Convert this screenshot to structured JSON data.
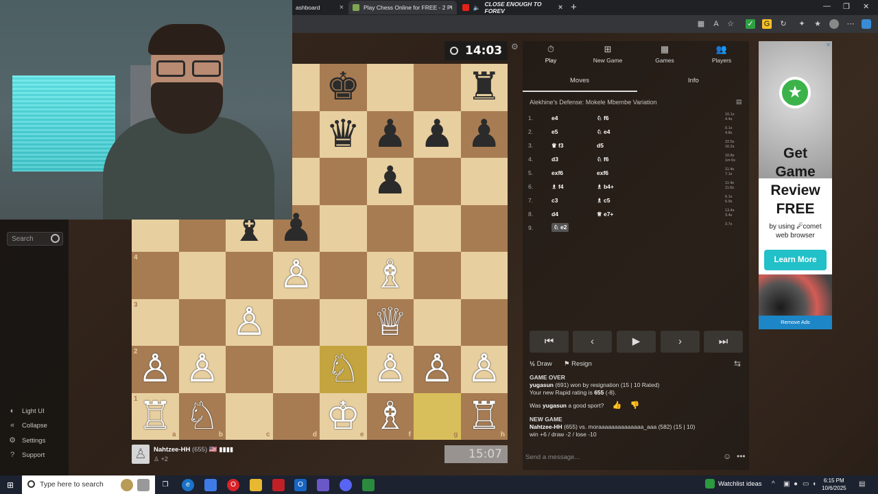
{
  "browser": {
    "tabs": [
      {
        "label": "ashboard",
        "active": false
      },
      {
        "label": "Play Chess Online for FREE - 2 Pl",
        "active": true
      },
      {
        "label": "CLOSE ENOUGH TO FOREV",
        "active": false
      }
    ],
    "new_tab": "+",
    "controls": [
      "—",
      "❐",
      "✕"
    ]
  },
  "sidebar": {
    "search_placeholder": "Search",
    "items": [
      {
        "label": "Light UI",
        "icon": "contrast-icon"
      },
      {
        "label": "Collapse",
        "icon": "collapse-icon"
      },
      {
        "label": "Settings",
        "icon": "gear-icon"
      },
      {
        "label": "Support",
        "icon": "help-icon"
      }
    ]
  },
  "top_timer": "14:03",
  "board": {
    "files": [
      "a",
      "b",
      "c",
      "d",
      "e",
      "f",
      "g",
      "h"
    ],
    "rank_labels_shown": [
      "4",
      "3",
      "2",
      "1"
    ],
    "pieces": [
      {
        "sq": "e8",
        "p": "♚",
        "c": "b"
      },
      {
        "sq": "h8",
        "p": "♜",
        "c": "b"
      },
      {
        "sq": "e7",
        "p": "♛",
        "c": "b"
      },
      {
        "sq": "f7",
        "p": "♟",
        "c": "b"
      },
      {
        "sq": "g7",
        "p": "♟",
        "c": "b"
      },
      {
        "sq": "h7",
        "p": "♟",
        "c": "b"
      },
      {
        "sq": "f6",
        "p": "♟",
        "c": "b"
      },
      {
        "sq": "c5",
        "p": "♝",
        "c": "b"
      },
      {
        "sq": "d5",
        "p": "♟",
        "c": "b"
      },
      {
        "sq": "d4",
        "p": "♙",
        "c": "w"
      },
      {
        "sq": "f4",
        "p": "♗",
        "c": "w"
      },
      {
        "sq": "c3",
        "p": "♙",
        "c": "w"
      },
      {
        "sq": "f3",
        "p": "♕",
        "c": "w"
      },
      {
        "sq": "a2",
        "p": "♙",
        "c": "w"
      },
      {
        "sq": "b2",
        "p": "♙",
        "c": "w"
      },
      {
        "sq": "e2",
        "p": "♘",
        "c": "w"
      },
      {
        "sq": "f2",
        "p": "♙",
        "c": "w"
      },
      {
        "sq": "g2",
        "p": "♙",
        "c": "w"
      },
      {
        "sq": "h2",
        "p": "♙",
        "c": "w"
      },
      {
        "sq": "a1",
        "p": "♖",
        "c": "w"
      },
      {
        "sq": "b1",
        "p": "♘",
        "c": "w"
      },
      {
        "sq": "e1",
        "p": "♔",
        "c": "w"
      },
      {
        "sq": "f1",
        "p": "♗",
        "c": "w"
      },
      {
        "sq": "h1",
        "p": "♖",
        "c": "w"
      }
    ],
    "highlight": [
      "e2",
      "g1"
    ],
    "colors": {
      "light": "#e8cf9f",
      "dark": "#a87c52",
      "highlight": "#c4a43f"
    }
  },
  "player": {
    "name": "Nahtzee-HH",
    "rating": "(655)",
    "flag": "🇺🇸 ▮▮▮▮",
    "score": "+2",
    "clock": "15:07"
  },
  "panel": {
    "nav": [
      {
        "label": "Play",
        "icon": "stopwatch-icon"
      },
      {
        "label": "New Game",
        "icon": "plus-icon"
      },
      {
        "label": "Games",
        "icon": "board-icon"
      },
      {
        "label": "Players",
        "icon": "players-icon"
      }
    ],
    "subtabs": [
      "Moves",
      "Info"
    ],
    "opening": "Alekhine's Defense: Mokele Mbembe Variation",
    "moves": [
      {
        "n": "1.",
        "w": "e4",
        "b": "♘ f6",
        "t": [
          "10.1s",
          "4.4s"
        ]
      },
      {
        "n": "2.",
        "w": "e5",
        "b": "♘ e4",
        "t": [
          "0.1s",
          "4.8s"
        ]
      },
      {
        "n": "3.",
        "w": "♛ f3",
        "b": "d5",
        "t": [
          "22.5s",
          "16.2s"
        ]
      },
      {
        "n": "4.",
        "w": "d3",
        "b": "♘ f6",
        "t": [
          "10.8s",
          "1m 6s"
        ]
      },
      {
        "n": "5.",
        "w": "exf6",
        "b": "exf6",
        "t": [
          "11.4s",
          "7.1s"
        ]
      },
      {
        "n": "6.",
        "w": "♗ f4",
        "b": "♗ b4+",
        "t": [
          "11.4s",
          "11.6s"
        ]
      },
      {
        "n": "7.",
        "w": "c3",
        "b": "♗ c5",
        "t": [
          "6.1s",
          "6.9s"
        ]
      },
      {
        "n": "8.",
        "w": "d4",
        "b": "♕ e7+",
        "t": [
          "13.4s",
          "3.4s"
        ]
      },
      {
        "n": "9.",
        "w": "♘ e2",
        "b": "",
        "t": [
          "3.7s"
        ]
      }
    ],
    "controls": [
      "⏮",
      "‹",
      "▶",
      "›",
      "⏭"
    ],
    "draw_label": "Draw",
    "draw_icon": "½",
    "resign_label": "Resign",
    "log": {
      "game_over": "GAME OVER",
      "winner": "yugasun",
      "winner_rest": " (691) won by resignation (15 | 10 Rated)",
      "rating_line_pre": "Your new Rapid rating is ",
      "rating_value": "655",
      "rating_line_post": " (-8).",
      "sport_pre": "Was ",
      "sport_user": "yugasun",
      "sport_post": " a good sport?",
      "new_game": "NEW GAME",
      "ng_player": "Nahtzee-HH",
      "ng_rest": " (655) vs. moraaaaaaaaaaaaaa_aaa (582) (15 | 10)",
      "ng_stats": "win +6 / draw -2 / lose -10"
    },
    "message_placeholder": "Send a message..."
  },
  "ad": {
    "headline": [
      "Get",
      "Game",
      "Review",
      "FREE"
    ],
    "byline_pre": "by using",
    "brand": "comet",
    "byline_post": "web browser",
    "cta": "Learn More",
    "remove": "Remove Ads"
  },
  "taskbar": {
    "search_placeholder": "Type here to search",
    "watchlist": "Watchlist ideas",
    "time": "6:15 PM",
    "date": "10/6/2025"
  }
}
